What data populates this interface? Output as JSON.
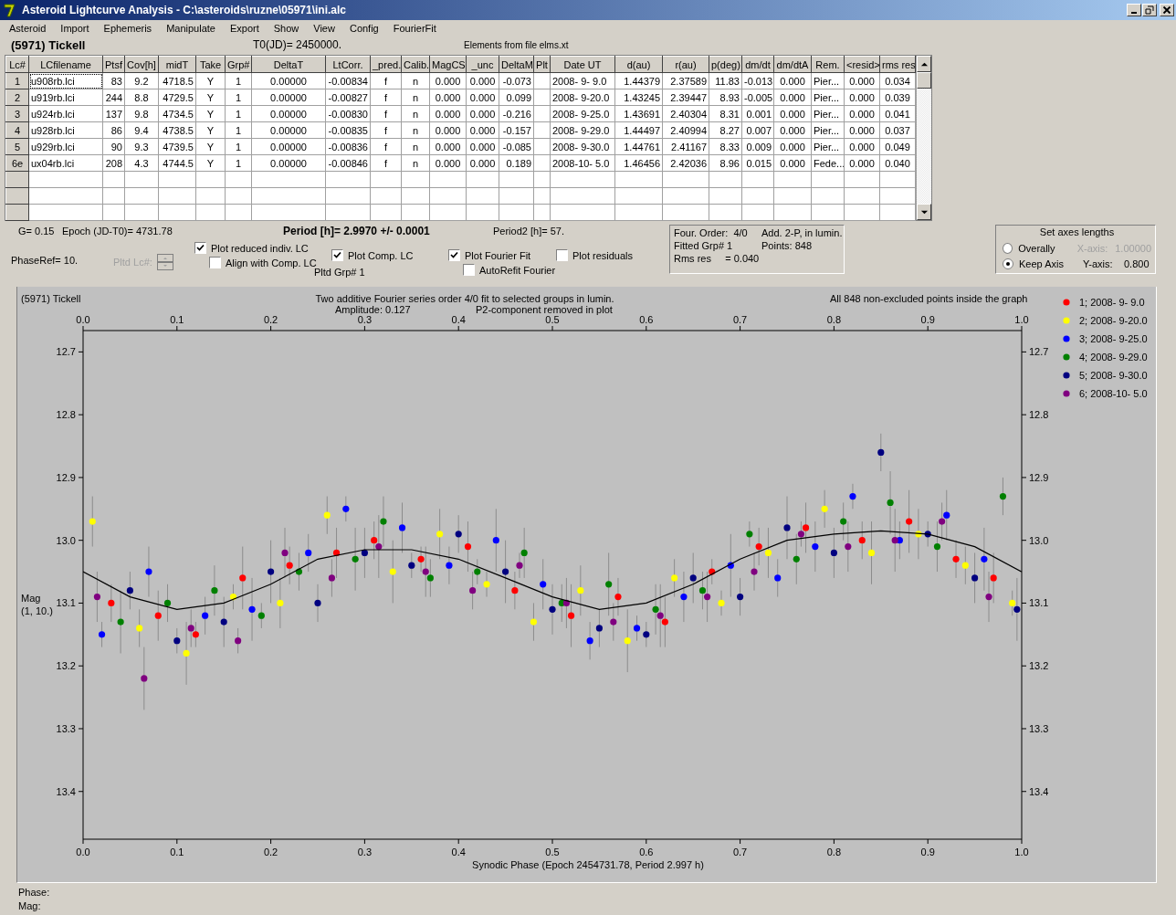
{
  "window": {
    "title": "Asteroid Lightcurve Analysis - C:\\asteroids\\ruzne\\05971\\ini.alc"
  },
  "menu": [
    "Asteroid",
    "Import",
    "Ephemeris",
    "Manipulate",
    "Export",
    "Show",
    "View",
    "Config",
    "FourierFit"
  ],
  "header": {
    "object": "(5971) Tickell",
    "t0": "T0(JD)= 2450000.",
    "elements": "Elements from file elms.xt"
  },
  "table": {
    "columns": [
      "Lc#",
      "LCfilename",
      "Ptsf",
      "Cov[h]",
      "midT",
      "Take",
      "Grp#",
      "DeltaT",
      "LtCorr.",
      "_pred.",
      "Calib.",
      "MagCS",
      "_unc",
      "DeltaM",
      "Plt",
      "Date UT",
      "d(au)",
      "r(au)",
      "p(deg)",
      "dm/dt",
      "dm/dtA",
      "Rem.",
      "<resid>",
      "rms res"
    ],
    "rows": [
      {
        "focused": true,
        "cells": [
          "1",
          "u908rb.lci",
          "83",
          "9.2",
          "4718.5",
          "Y",
          "1",
          "0.00000",
          "-0.00834",
          "f",
          "n",
          "0.000",
          "0.000",
          "-0.073",
          null,
          "2008- 9- 9.0",
          "1.44379",
          "2.37589",
          "11.83",
          "-0.013",
          "0.000",
          "Pier...",
          "0.000",
          "0.034"
        ]
      },
      {
        "focused": false,
        "cells": [
          "2",
          "u919rb.lci",
          "244",
          "8.8",
          "4729.5",
          "Y",
          "1",
          "0.00000",
          "-0.00827",
          "f",
          "n",
          "0.000",
          "0.000",
          "0.099",
          null,
          "2008- 9-20.0",
          "1.43245",
          "2.39447",
          "8.93",
          "-0.005",
          "0.000",
          "Pier...",
          "0.000",
          "0.039"
        ]
      },
      {
        "focused": false,
        "cells": [
          "3",
          "u924rb.lci",
          "137",
          "9.8",
          "4734.5",
          "Y",
          "1",
          "0.00000",
          "-0.00830",
          "f",
          "n",
          "0.000",
          "0.000",
          "-0.216",
          null,
          "2008- 9-25.0",
          "1.43691",
          "2.40304",
          "8.31",
          "0.001",
          "0.000",
          "Pier...",
          "0.000",
          "0.041"
        ]
      },
      {
        "focused": false,
        "cells": [
          "4",
          "u928rb.lci",
          "86",
          "9.4",
          "4738.5",
          "Y",
          "1",
          "0.00000",
          "-0.00835",
          "f",
          "n",
          "0.000",
          "0.000",
          "-0.157",
          null,
          "2008- 9-29.0",
          "1.44497",
          "2.40994",
          "8.27",
          "0.007",
          "0.000",
          "Pier...",
          "0.000",
          "0.037"
        ]
      },
      {
        "focused": false,
        "cells": [
          "5",
          "u929rb.lci",
          "90",
          "9.3",
          "4739.5",
          "Y",
          "1",
          "0.00000",
          "-0.00836",
          "f",
          "n",
          "0.000",
          "0.000",
          "-0.085",
          null,
          "2008- 9-30.0",
          "1.44761",
          "2.41167",
          "8.33",
          "0.009",
          "0.000",
          "Pier...",
          "0.000",
          "0.049"
        ]
      },
      {
        "focused": false,
        "cells": [
          "6e",
          "ux04rb.lci",
          "208",
          "4.3",
          "4744.5",
          "Y",
          "1",
          "0.00000",
          "-0.00846",
          "f",
          "n",
          "0.000",
          "0.000",
          "0.189",
          null,
          "2008-10- 5.0",
          "1.46456",
          "2.42036",
          "8.96",
          "0.015",
          "0.000",
          "Fede...",
          "0.000",
          "0.040"
        ]
      }
    ]
  },
  "info": {
    "g": "G= 0.15",
    "epoch": "Epoch (JD-T0)= 4731.78",
    "period": "Period [h]= 2.9970 +/- 0.0001",
    "period2": "Period2 [h]= 57.",
    "phase_ref": "PhaseRef= 10."
  },
  "spinner": {
    "label": "Pltd Lc#:",
    "disabled": true
  },
  "checkboxes": [
    {
      "label": "Plot reduced indiv. LC",
      "checked": true
    },
    {
      "label": "Align with Comp. LC",
      "checked": false
    },
    {
      "label": "Plot Comp. LC",
      "checked": true
    },
    {
      "label": "Plot Fourier Fit",
      "checked": true
    },
    {
      "label": "AutoRefit Fourier",
      "checked": false
    },
    {
      "label": "Plot residuals",
      "checked": false
    }
  ],
  "pltd_grp": "Pltd Grp#  1",
  "fit_box": [
    "Four. Order:  4/0",
    "Add. 2-P, in lumin.",
    "Fitted Grp# 1",
    "Points: 848",
    "Rms res     = 0.040"
  ],
  "axes_box": {
    "title": "Set axes lengths",
    "options": [
      {
        "label": "Overally",
        "selected": false,
        "axis_label": "X-axis:",
        "axis_value": "1.00000",
        "disabled": true
      },
      {
        "label": "Keep Axis",
        "selected": true,
        "axis_label": "Y-axis:",
        "axis_value": "0.800",
        "disabled": false
      }
    ]
  },
  "plot": {
    "object": "(5971) Tickell",
    "amplitude": "Amplitude: 0.127",
    "p2_note": "P2-component removed in plot",
    "points_note": "All 848 non-excluded points inside the graph",
    "ylabel_note": "(1, 10.)",
    "chart_data": {
      "type": "scatter",
      "title": "Two additive Fourier series order 4/0 fit to selected groups in lumin.",
      "xlabel": "Synodic Phase (Epoch 2454731.78, Period 2.997 h)",
      "ylabel": "Mag",
      "xlim": [
        0,
        1
      ],
      "ylim": [
        13.476,
        12.666
      ],
      "legend": "right",
      "xticks": [
        {
          "value": 0,
          "label": "0.0"
        },
        {
          "value": 0.1,
          "label": "0.1"
        },
        {
          "value": 0.2,
          "label": "0.2"
        },
        {
          "value": 0.3,
          "label": "0.3"
        },
        {
          "value": 0.4,
          "label": "0.4"
        },
        {
          "value": 0.5,
          "label": "0.5"
        },
        {
          "value": 0.6,
          "label": "0.6"
        },
        {
          "value": 0.7,
          "label": "0.7"
        },
        {
          "value": 0.8,
          "label": "0.8"
        },
        {
          "value": 0.9,
          "label": "0.9"
        },
        {
          "value": 1,
          "label": "1.0"
        }
      ],
      "yticks": [
        {
          "value": 12.7,
          "label": "12.7"
        },
        {
          "value": 12.8,
          "label": "12.8"
        },
        {
          "value": 12.9,
          "label": "12.9"
        },
        {
          "value": 13.0,
          "label": "13.0"
        },
        {
          "value": 13.1,
          "label": "13.1"
        },
        {
          "value": 13.2,
          "label": "13.2"
        },
        {
          "value": 13.3,
          "label": "13.3"
        },
        {
          "value": 13.4,
          "label": "13.4"
        }
      ],
      "series": [
        {
          "type": "scatter",
          "name": "1; 2008- 9- 9.0",
          "color": "#ff0000",
          "x": [
            0.03,
            0.08,
            0.12,
            0.17,
            0.22,
            0.27,
            0.31,
            0.36,
            0.41,
            0.46,
            0.52,
            0.57,
            0.62,
            0.67,
            0.72,
            0.77,
            0.83,
            0.88,
            0.93,
            0.97
          ],
          "values": [
            13.1,
            13.12,
            13.15,
            13.06,
            13.04,
            13.02,
            13.0,
            13.03,
            13.01,
            13.08,
            13.12,
            13.09,
            13.13,
            13.05,
            13.01,
            12.98,
            13.0,
            12.97,
            13.03,
            13.06
          ],
          "errors": [
            0.03,
            0.04,
            0.02,
            0.05,
            0.03,
            0.04,
            0.03,
            0.02,
            0.04,
            0.03,
            0.05,
            0.03,
            0.04,
            0.02,
            0.03,
            0.04,
            0.03,
            0.05,
            0.03,
            0.04
          ]
        },
        {
          "type": "scatter",
          "name": "2; 2008- 9-20.0",
          "color": "#ffff00",
          "x": [
            0.01,
            0.06,
            0.11,
            0.16,
            0.21,
            0.26,
            0.33,
            0.38,
            0.43,
            0.48,
            0.53,
            0.58,
            0.63,
            0.68,
            0.73,
            0.79,
            0.84,
            0.89,
            0.94,
            0.99
          ],
          "values": [
            12.97,
            13.14,
            13.18,
            13.09,
            13.1,
            12.96,
            13.05,
            12.99,
            13.07,
            13.13,
            13.08,
            13.16,
            13.06,
            13.1,
            13.02,
            12.95,
            13.02,
            12.99,
            13.04,
            13.1
          ],
          "errors": [
            0.04,
            0.03,
            0.05,
            0.02,
            0.04,
            0.03,
            0.05,
            0.04,
            0.02,
            0.03,
            0.04,
            0.05,
            0.03,
            0.02,
            0.04,
            0.03,
            0.05,
            0.04,
            0.03,
            0.02
          ]
        },
        {
          "type": "scatter",
          "name": "3; 2008- 9-25.0",
          "color": "#0000ff",
          "x": [
            0.02,
            0.07,
            0.13,
            0.18,
            0.24,
            0.28,
            0.34,
            0.39,
            0.44,
            0.49,
            0.54,
            0.59,
            0.64,
            0.69,
            0.74,
            0.78,
            0.82,
            0.87,
            0.92,
            0.96
          ],
          "values": [
            13.15,
            13.05,
            13.12,
            13.11,
            13.02,
            12.95,
            12.98,
            13.04,
            13.0,
            13.07,
            13.16,
            13.14,
            13.09,
            13.04,
            13.06,
            13.01,
            12.93,
            13.0,
            12.96,
            13.03
          ],
          "errors": [
            0.02,
            0.04,
            0.03,
            0.05,
            0.03,
            0.02,
            0.04,
            0.03,
            0.05,
            0.04,
            0.03,
            0.02,
            0.04,
            0.05,
            0.03,
            0.04,
            0.02,
            0.03,
            0.04,
            0.05
          ]
        },
        {
          "type": "scatter",
          "name": "4; 2008- 9-29.0",
          "color": "#008000",
          "x": [
            0.04,
            0.09,
            0.14,
            0.19,
            0.23,
            0.29,
            0.32,
            0.37,
            0.42,
            0.47,
            0.51,
            0.56,
            0.61,
            0.66,
            0.71,
            0.76,
            0.81,
            0.86,
            0.91,
            0.98
          ],
          "values": [
            13.13,
            13.1,
            13.08,
            13.12,
            13.05,
            13.03,
            12.97,
            13.06,
            13.05,
            13.02,
            13.1,
            13.07,
            13.11,
            13.08,
            12.99,
            13.03,
            12.97,
            12.94,
            13.01,
            12.93
          ],
          "errors": [
            0.05,
            0.03,
            0.04,
            0.02,
            0.03,
            0.05,
            0.04,
            0.03,
            0.02,
            0.04,
            0.03,
            0.05,
            0.04,
            0.03,
            0.02,
            0.04,
            0.03,
            0.05,
            0.04,
            0.03
          ]
        },
        {
          "type": "scatter",
          "name": "5; 2008- 9-30.0",
          "color": "#000080",
          "x": [
            0.05,
            0.1,
            0.15,
            0.2,
            0.25,
            0.3,
            0.35,
            0.4,
            0.45,
            0.5,
            0.55,
            0.6,
            0.65,
            0.7,
            0.75,
            0.8,
            0.85,
            0.9,
            0.95,
            0.995
          ],
          "values": [
            13.08,
            13.16,
            13.13,
            13.05,
            13.1,
            13.02,
            13.04,
            12.99,
            13.05,
            13.11,
            13.14,
            13.15,
            13.06,
            13.09,
            12.98,
            13.02,
            12.86,
            12.99,
            13.06,
            13.11
          ],
          "errors": [
            0.03,
            0.02,
            0.04,
            0.05,
            0.03,
            0.04,
            0.02,
            0.03,
            0.05,
            0.04,
            0.03,
            0.02,
            0.04,
            0.03,
            0.05,
            0.04,
            0.03,
            0.02,
            0.04,
            0.05
          ]
        },
        {
          "type": "scatter",
          "name": "6; 2008-10- 5.0",
          "color": "#800080",
          "x": [
            0.015,
            0.065,
            0.115,
            0.165,
            0.215,
            0.265,
            0.315,
            0.365,
            0.415,
            0.465,
            0.515,
            0.565,
            0.615,
            0.665,
            0.715,
            0.765,
            0.815,
            0.865,
            0.915,
            0.965
          ],
          "values": [
            13.09,
            13.22,
            13.14,
            13.16,
            13.02,
            13.06,
            13.01,
            13.05,
            13.08,
            13.04,
            13.1,
            13.13,
            13.12,
            13.09,
            13.05,
            12.99,
            13.01,
            13.0,
            12.97,
            13.09
          ],
          "errors": [
            0.04,
            0.05,
            0.03,
            0.02,
            0.04,
            0.03,
            0.05,
            0.04,
            0.03,
            0.02,
            0.04,
            0.03,
            0.05,
            0.04,
            0.03,
            0.02,
            0.04,
            0.05,
            0.03,
            0.04
          ]
        },
        {
          "type": "line",
          "color": "#000000",
          "x": [
            0,
            0.05,
            0.1,
            0.15,
            0.2,
            0.25,
            0.3,
            0.35,
            0.4,
            0.45,
            0.5,
            0.55,
            0.6,
            0.65,
            0.7,
            0.75,
            0.8,
            0.85,
            0.9,
            0.95,
            1
          ],
          "values": [
            13.05,
            13.09,
            13.11,
            13.1,
            13.07,
            13.03,
            13.015,
            13.015,
            13.03,
            13.06,
            13.09,
            13.11,
            13.1,
            13.07,
            13.03,
            13.0,
            12.99,
            12.985,
            12.99,
            13.01,
            13.05
          ]
        }
      ]
    }
  },
  "status": {
    "phase": "Phase:",
    "mag": "Mag:"
  }
}
